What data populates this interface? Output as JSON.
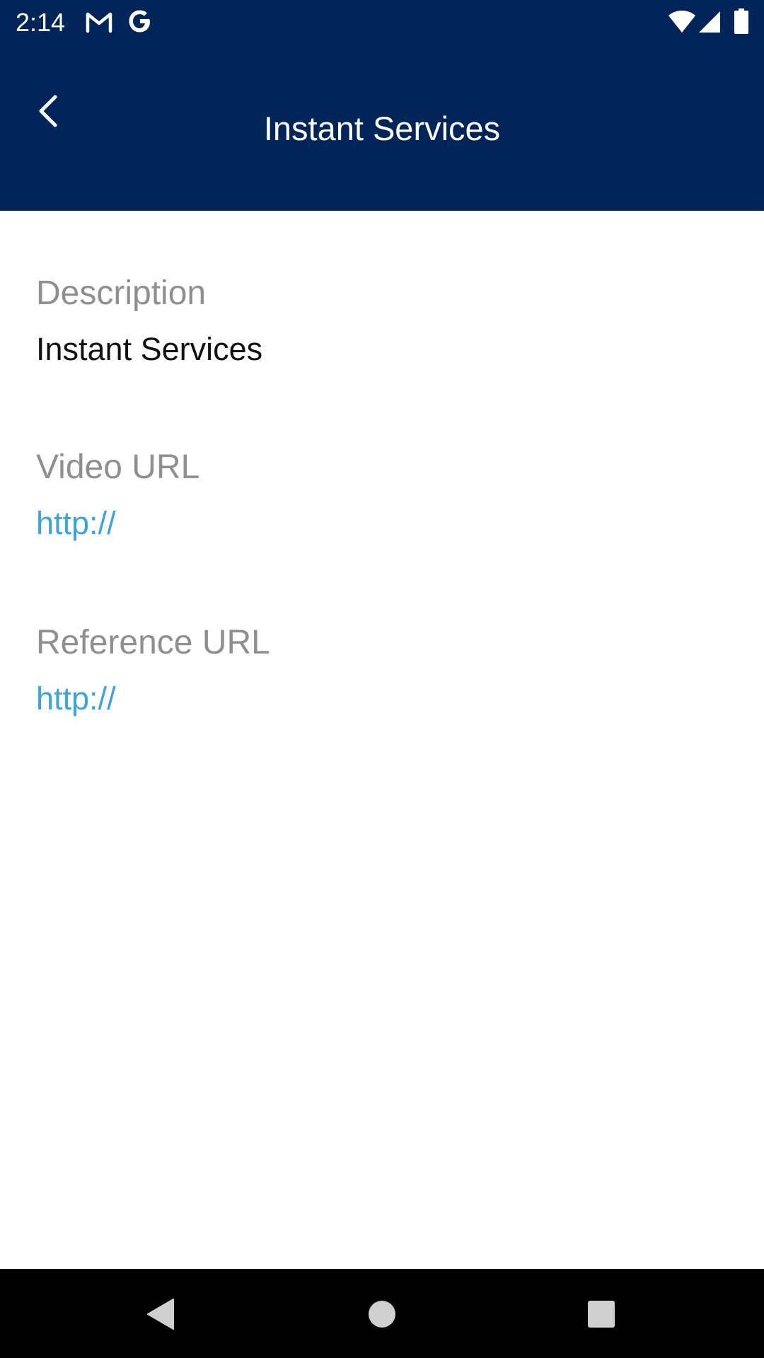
{
  "status_bar": {
    "time": "2:14",
    "icons": [
      "gmail-icon",
      "google-icon",
      "wifi-icon",
      "signal-icon",
      "battery-icon"
    ]
  },
  "app_bar": {
    "title": "Instant Services",
    "back_icon": "chevron-left-icon"
  },
  "details": {
    "description": {
      "label": "Description",
      "value": "Instant Services"
    },
    "video_url": {
      "label": "Video URL",
      "value": "http://"
    },
    "reference_url": {
      "label": "Reference URL",
      "value": "http://"
    }
  },
  "nav_bar": {
    "icons": [
      "nav-back-icon",
      "nav-home-icon",
      "nav-recents-icon"
    ]
  },
  "colors": {
    "header_bg": "#012459",
    "label": "#8f8f8f",
    "value": "#111111",
    "link": "#3ba5d9",
    "nav_bg": "#000000"
  }
}
